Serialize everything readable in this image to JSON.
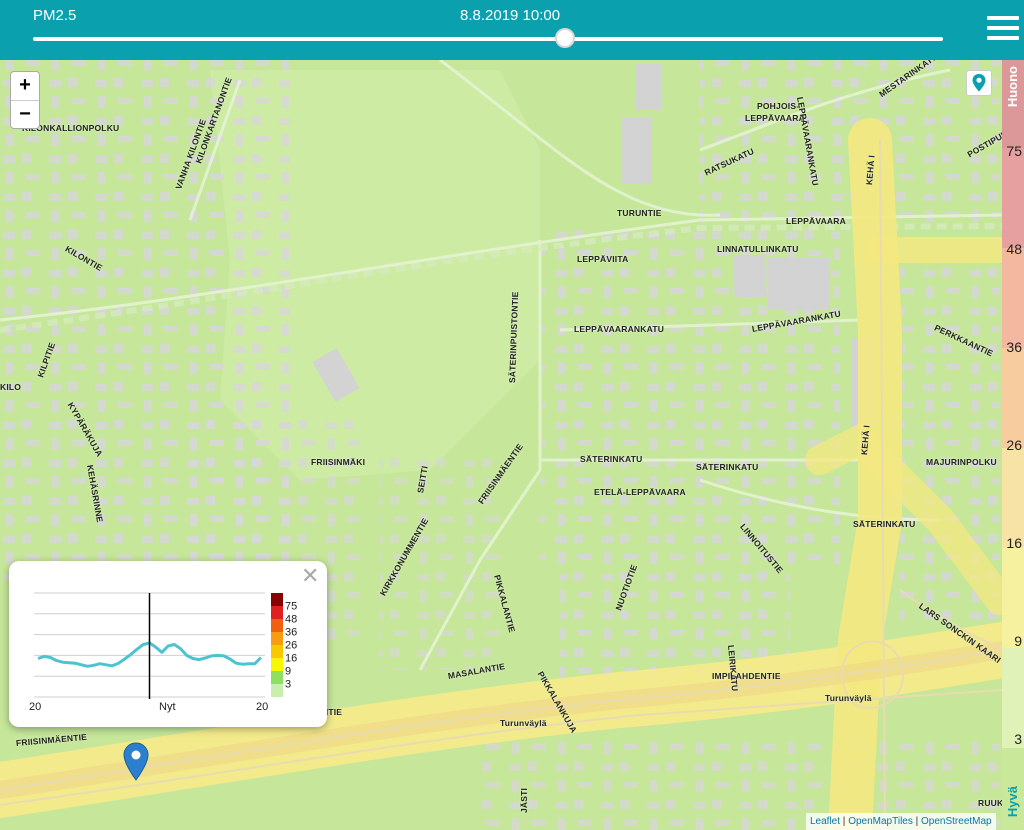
{
  "header": {
    "pollutant": "PM2.5",
    "datetime": "8.8.2019 10:00",
    "slider_value": 0.585
  },
  "map": {
    "labels": [
      {
        "text": "KILONKALLIONPOLKU",
        "angle": 0
      },
      {
        "text": "VANHA KILONTIE",
        "angle": -70
      },
      {
        "text": "KILONKARTANONTIE",
        "angle": -70
      },
      {
        "text": "KILONTIE",
        "angle": 30
      },
      {
        "text": "KILPITIE",
        "angle": -70
      },
      {
        "text": "KYPÄRÄKUJA",
        "angle": 60
      },
      {
        "text": "KEHÄSRINNE",
        "angle": 80
      },
      {
        "text": "KILO",
        "angle": 0
      },
      {
        "text": "POHJOIS-",
        "angle": 0
      },
      {
        "text": "LEPPÄVAARA",
        "angle": 0
      },
      {
        "text": "LEPPÄVAARANKATU",
        "angle": 80
      },
      {
        "text": "MESTARINKATU",
        "angle": -35
      },
      {
        "text": "POSTIPUU",
        "angle": -30
      },
      {
        "text": "RATSUKATU",
        "angle": -25
      },
      {
        "text": "TURUNTIE",
        "angle": 0
      },
      {
        "text": "LEPPÄVAARA",
        "angle": 0
      },
      {
        "text": "KEHÄ I",
        "angle": -85
      },
      {
        "text": "LINNATULLINKATU",
        "angle": 0
      },
      {
        "text": "LEPPÄVIITA",
        "angle": 0
      },
      {
        "text": "LEPPÄVAARANKATU",
        "angle": 0
      },
      {
        "text": "LEPPÄVAARANKATU",
        "angle": -10
      },
      {
        "text": "PERKKAANTIE",
        "angle": 25
      },
      {
        "text": "SÄTERINPUISTONTIE",
        "angle": -88
      },
      {
        "text": "SÄTERINKATU",
        "angle": 0
      },
      {
        "text": "SÄTERINKATU",
        "angle": 0
      },
      {
        "text": "KEHÄ I",
        "angle": -85
      },
      {
        "text": "MAJURINPOLKU",
        "angle": 0
      },
      {
        "text": "FRIISINMÄKI",
        "angle": 0
      },
      {
        "text": "SEITTI",
        "angle": -80
      },
      {
        "text": "FRIISINMÄENTIE",
        "angle": -55
      },
      {
        "text": "ETELÄ-LEPPÄVAARA",
        "angle": 0
      },
      {
        "text": "LINNOITUSTIE",
        "angle": 50
      },
      {
        "text": "SÄTERINKATU",
        "angle": 0
      },
      {
        "text": "KIRKKONUMMENTIE",
        "angle": -60
      },
      {
        "text": "PIKKALANTIE",
        "angle": 75
      },
      {
        "text": "NUOTIOTIE",
        "angle": -70
      },
      {
        "text": "LEIRIKATU",
        "angle": 85
      },
      {
        "text": "LARS SONCKIN KAARI",
        "angle": 35
      },
      {
        "text": "PIKKALANKUJA",
        "angle": 60
      },
      {
        "text": "MASALANTIE",
        "angle": -10
      },
      {
        "text": "IMPILAHDENTIE",
        "angle": 0
      },
      {
        "text": "Turunväylä",
        "angle": 0
      },
      {
        "text": "Turunväylä",
        "angle": 0
      },
      {
        "text": "FRIISINMÄENTIE",
        "angle": -5
      },
      {
        "text": "NTIE",
        "angle": 0
      },
      {
        "text": "JÄSTI",
        "angle": -90
      },
      {
        "text": "RUUK",
        "angle": 0
      }
    ]
  },
  "scale": {
    "top_label": "Huono",
    "bottom_label": "Hyvä",
    "ticks": [
      "75",
      "48",
      "36",
      "26",
      "16",
      "9",
      "3"
    ],
    "colors": {
      "band75": "#e6a0a0",
      "band48": "#f4b7a0",
      "band36": "#f7cda0",
      "band26": "#f8e3a6",
      "band16": "#f6f19e",
      "band9": "#e0f2b8",
      "band3": "#c9e89a"
    }
  },
  "popup": {
    "close_symbol": "✕",
    "x_labels": [
      "20",
      "Nyt",
      "20"
    ],
    "legend": [
      {
        "label": "75",
        "color": "#8b0000"
      },
      {
        "label": "48",
        "color": "#e02020"
      },
      {
        "label": "36",
        "color": "#f06010"
      },
      {
        "label": "26",
        "color": "#f89c10"
      },
      {
        "label": "16",
        "color": "#f8c800"
      },
      {
        "label": "9",
        "color": "#f8f800"
      },
      {
        "label": "3",
        "color": "#90e060"
      },
      {
        "label": "",
        "color": "#c8eeb0"
      }
    ],
    "series_color": "#4cc4d0",
    "values": [
      7.4,
      7.8,
      7.6,
      7.0,
      6.7,
      6.6,
      6.5,
      6.2,
      5.9,
      6.1,
      6.4,
      6.2,
      6.0,
      6.5,
      7.3,
      8.2,
      9.2,
      10.1,
      10.4,
      9.6,
      8.6,
      9.8,
      10.1,
      9.3,
      8.0,
      7.4,
      7.2,
      7.5,
      7.9,
      8.0,
      7.9,
      7.3,
      6.5,
      6.3,
      6.4,
      6.4,
      7.6
    ],
    "now_index": 18
  },
  "attribution": {
    "leaflet": "Leaflet",
    "tiles": "OpenMapTiles",
    "osm": "OpenStreetMap"
  },
  "icons": {
    "marker": "map-pin-icon",
    "locate": "location-pin-icon",
    "menu": "menu-icon"
  }
}
